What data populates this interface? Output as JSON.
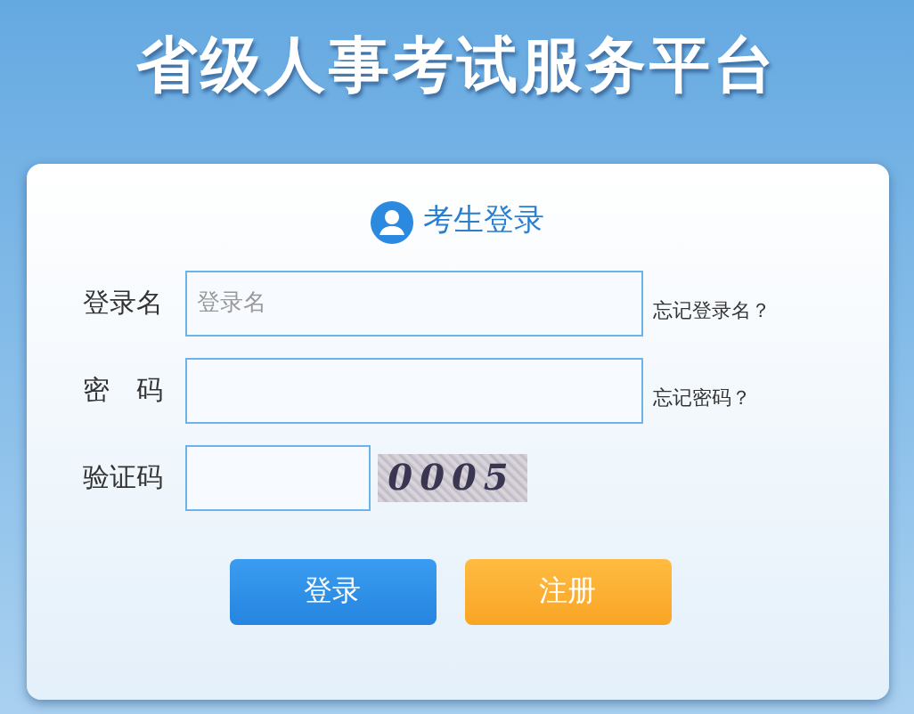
{
  "page_title": "省级人事考试服务平台",
  "login_card": {
    "heading": "考生登录",
    "fields": [
      {
        "kind": "text",
        "label": "登录名",
        "placeholder": "登录名",
        "link": "忘记登录名？"
      },
      {
        "kind": "password",
        "label": "密　码",
        "link": "忘记密码？"
      },
      {
        "kind": "captcha",
        "label": "验证码",
        "captcha": "0005"
      }
    ],
    "buttons": [
      {
        "kind": "primary",
        "label": "登录"
      },
      {
        "kind": "secondary",
        "label": "注册"
      }
    ]
  }
}
